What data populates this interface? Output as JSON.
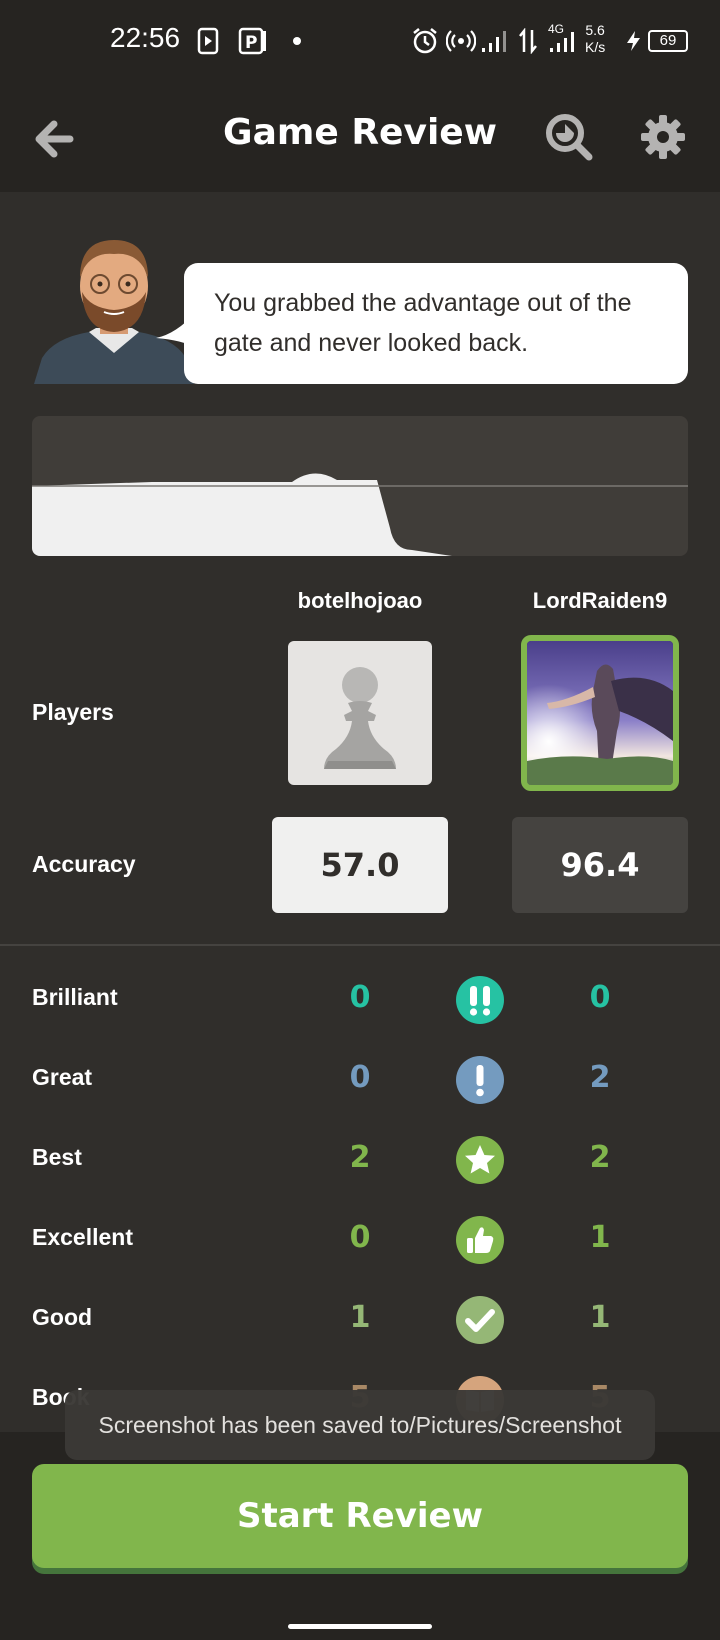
{
  "status_bar": {
    "time": "22:56",
    "network_speed_value": "5.6",
    "network_speed_unit": "K/s",
    "network_type": "4G",
    "battery": "69",
    "icons": [
      "screen-record-icon",
      "parking-app-icon",
      "dot-icon",
      "alarm-icon",
      "hotspot-icon",
      "signal-icon",
      "data-transfer-icon",
      "signal-4g-icon",
      "charging-icon",
      "battery-icon"
    ]
  },
  "header": {
    "title": "Game Review",
    "back_icon": "arrow-left-icon",
    "search_icon": "analysis-search-icon",
    "settings_icon": "gear-icon"
  },
  "coach": {
    "message": "You grabbed the advantage out of the gate and never looked back."
  },
  "players": {
    "label": "Players",
    "white": {
      "name": "botelhojoao",
      "avatar": "pawn-avatar"
    },
    "black": {
      "name": "LordRaiden9",
      "avatar": "anime-avatar"
    }
  },
  "accuracy": {
    "label": "Accuracy",
    "white": "57.0",
    "black": "96.4"
  },
  "stats": [
    {
      "label": "Brilliant",
      "white": "0",
      "black": "0",
      "icon": "brilliant-icon",
      "color": "#26c2a3"
    },
    {
      "label": "Great",
      "white": "0",
      "black": "2",
      "icon": "great-move-icon",
      "color": "#749bbf"
    },
    {
      "label": "Best",
      "white": "2",
      "black": "2",
      "icon": "star-icon",
      "color": "#81b64c"
    },
    {
      "label": "Excellent",
      "white": "0",
      "black": "1",
      "icon": "thumbs-up-icon",
      "color": "#81b64c"
    },
    {
      "label": "Good",
      "white": "1",
      "black": "1",
      "icon": "checkmark-icon",
      "color": "#95b776"
    },
    {
      "label": "Book",
      "white": "5",
      "black": "5",
      "icon": "book-icon",
      "color": "#d5a47d"
    }
  ],
  "toast": {
    "text": "Screenshot has been saved to/Pictures/Screenshot"
  },
  "footer": {
    "start_review_label": "Start Review"
  },
  "colors": {
    "background": "#302e2b",
    "header_bg": "#262421",
    "accent_green": "#81b64c"
  }
}
